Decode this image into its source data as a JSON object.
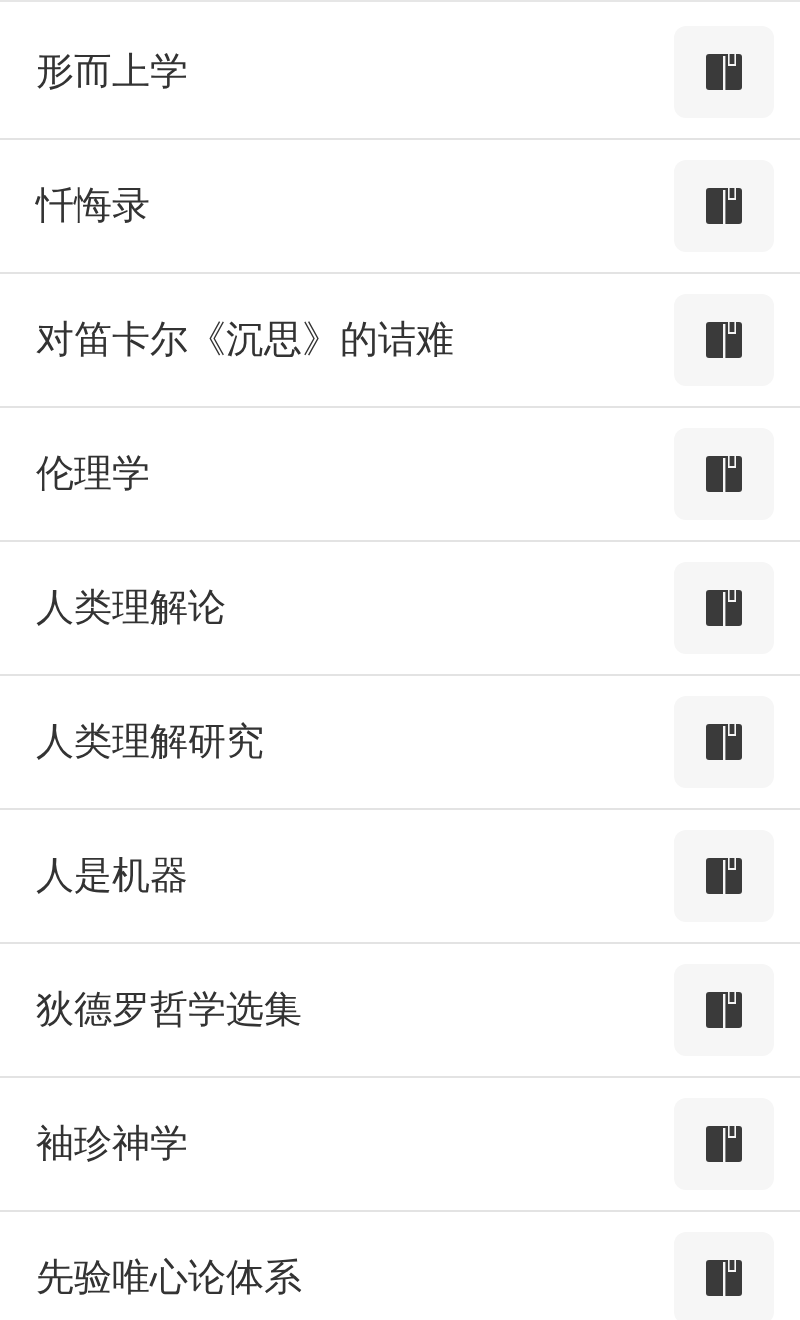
{
  "books": [
    {
      "title": "形而上学"
    },
    {
      "title": "忏悔录"
    },
    {
      "title": "对笛卡尔《沉思》的诘难"
    },
    {
      "title": "伦理学"
    },
    {
      "title": "人类理解论"
    },
    {
      "title": "人类理解研究"
    },
    {
      "title": "人是机器"
    },
    {
      "title": "狄德罗哲学选集"
    },
    {
      "title": "袖珍神学"
    },
    {
      "title": "先验唯心论体系"
    }
  ]
}
